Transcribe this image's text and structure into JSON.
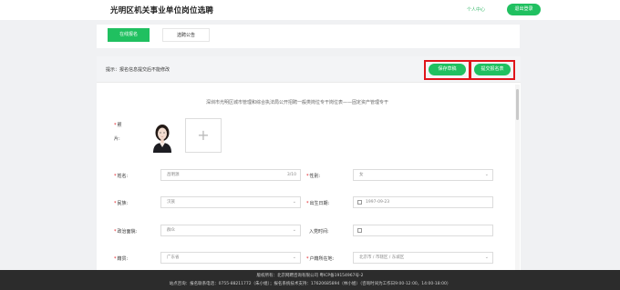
{
  "header": {
    "site_title": "光明区机关事业单位岗位选聘",
    "user_center": "个人中心",
    "logout": "退出登录"
  },
  "tabs": [
    {
      "label": "在线报名",
      "active": true
    },
    {
      "label": "选聘公告",
      "active": false
    }
  ],
  "form": {
    "hint": "提示：报名信息提交后不能修改",
    "save_draft": "保存草稿",
    "submit": "提交报名表",
    "position_line": "深圳市光明区城市管理和综合执法局公开招聘一般类岗位专干岗位表——固定资产管理专干",
    "photo_label_1": "照",
    "photo_label_2": "片:",
    "add_photo": "+",
    "fields": {
      "name": {
        "label": "姓名:",
        "value": "昌明源",
        "counter": "3/10"
      },
      "gender": {
        "label": "性别:",
        "value": "女"
      },
      "ethnicity": {
        "label": "民族:",
        "value": "汉族"
      },
      "birth_date": {
        "label": "出生日期:",
        "value": "1997-09-23"
      },
      "political_status": {
        "label": "政治面貌:",
        "value": "群众"
      },
      "party_join_date": {
        "label": "入党时间:",
        "value": ""
      },
      "native_place": {
        "label": "籍贯:",
        "value": "广东省"
      },
      "household_location": {
        "label": "户籍所在地:",
        "value": "北京市 / 市辖区 / 东城区"
      }
    }
  },
  "footer": {
    "line1": "版权所有：北京网聘咨询有限公司 粤ICP备19154967号-2",
    "line2": "站点咨询：报名联系电话：0755-88211772（朱小姐）；报名系统技术支持：17620685894（林小姐）（咨询时间为工作日9:00-12:00，14:00-18:00）"
  },
  "colors": {
    "accent": "#20c060",
    "highlight_frame": "#e0151b",
    "footer_bg": "#2c2c2c"
  }
}
